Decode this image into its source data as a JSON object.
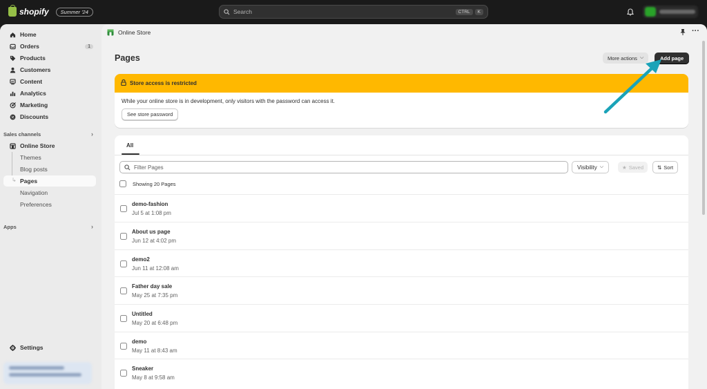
{
  "topbar": {
    "logo_text": "shopify",
    "edition_badge": "Summer '24",
    "search_placeholder": "Search",
    "shortcut_keys": [
      "CTRL",
      "K"
    ]
  },
  "sidebar": {
    "items": [
      {
        "label": "Home",
        "icon": "home-icon"
      },
      {
        "label": "Orders",
        "icon": "orders-icon",
        "count": "1"
      },
      {
        "label": "Products",
        "icon": "tag-icon"
      },
      {
        "label": "Customers",
        "icon": "person-icon"
      },
      {
        "label": "Content",
        "icon": "content-icon"
      },
      {
        "label": "Analytics",
        "icon": "bar-chart-icon"
      },
      {
        "label": "Marketing",
        "icon": "target-icon"
      },
      {
        "label": "Discounts",
        "icon": "discount-icon"
      }
    ],
    "sales_channels_title": "Sales channels",
    "online_store_label": "Online Store",
    "sub_items": [
      "Themes",
      "Blog posts",
      "Pages",
      "Navigation",
      "Preferences"
    ],
    "apps_title": "Apps",
    "settings_label": "Settings"
  },
  "main": {
    "breadcrumb": "Online Store",
    "page_title": "Pages",
    "more_actions_label": "More actions",
    "add_page_label": "Add page",
    "banner": {
      "title": "Store access is restricted",
      "message": "While your online store is in development, only visitors with the password can access it.",
      "button_label": "See store password"
    },
    "tabs": [
      "All"
    ],
    "filter_placeholder": "Filter Pages",
    "visibility_label": "Visibility",
    "saved_label": "Saved",
    "sort_label": "Sort",
    "showing_text": "Showing 20 Pages",
    "pages": [
      {
        "title": "demo-fashion",
        "date": "Jul 5 at 1:08 pm"
      },
      {
        "title": "About us page",
        "date": "Jun 12 at 4:02 pm"
      },
      {
        "title": "demo2",
        "date": "Jun 11 at 12:08 am"
      },
      {
        "title": "Father day sale",
        "date": "May 25 at 7:35 pm"
      },
      {
        "title": "Untitled",
        "date": "May 20 at 6:48 pm"
      },
      {
        "title": "demo",
        "date": "May 11 at 8:43 am"
      },
      {
        "title": "Sneaker",
        "date": "May 8 at 9:58 am"
      }
    ]
  },
  "colors": {
    "banner_yellow": "#ffb800",
    "primary_button": "#303030",
    "annotation_arrow": "#1aa3b8",
    "logo_green": "#95bf47"
  }
}
